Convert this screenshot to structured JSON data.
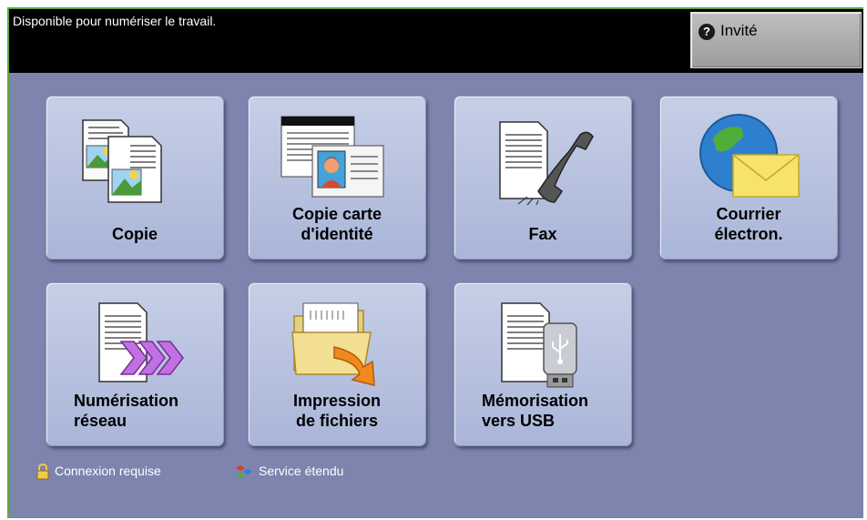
{
  "status_message": "Disponible pour numériser le travail.",
  "user_button": {
    "label": "Invité",
    "icon": "question-icon"
  },
  "services": [
    {
      "id": "copy",
      "label": "Copie",
      "icon": "copy-icon"
    },
    {
      "id": "id-card-copy",
      "label": "Copie carte\nd'identité",
      "icon": "id-card-icon"
    },
    {
      "id": "fax",
      "label": "Fax",
      "icon": "fax-icon"
    },
    {
      "id": "email",
      "label": "Courrier\nélectron.",
      "icon": "email-icon"
    },
    {
      "id": "network-scan",
      "label": "Numérisation\nréseau",
      "icon": "network-scan-icon"
    },
    {
      "id": "print-files",
      "label": "Impression\nde fichiers",
      "icon": "print-files-icon"
    },
    {
      "id": "usb-store",
      "label": "Mémorisation\nvers USB",
      "icon": "usb-icon"
    }
  ],
  "legend": {
    "login_required": "Connexion requise",
    "extended_service": "Service étendu"
  },
  "colors": {
    "background": "#7d84ad",
    "topbar": "#000000",
    "tile": "#b7c2e0",
    "border_accent": "#5fa843"
  }
}
